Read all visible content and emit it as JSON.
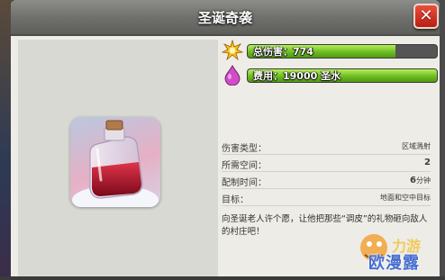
{
  "window": {
    "title": "圣诞奇袭"
  },
  "stats": [
    {
      "label": "总伤害：774",
      "icon": "damage-burst-icon",
      "fill": 0.78
    },
    {
      "label": "费用：19000 圣水",
      "icon": "elixir-drop-icon",
      "fill": 1.0
    }
  ],
  "info": [
    {
      "key": "伤害类型：",
      "value": "区域溅射",
      "small": true
    },
    {
      "key": "所需空间：",
      "value": "2",
      "small": false
    },
    {
      "key": "配制时间：",
      "value": "6",
      "unit": "分钟"
    },
    {
      "key": "目标：",
      "value": "地面和空中目标",
      "small": true
    }
  ],
  "description": "向圣诞老人许个愿，让他把那些“调皮”的礼物砸向敌人的村庄吧！",
  "watermark": {
    "text": "欧漫露"
  },
  "colors": {
    "bar_green": "#6ebd22",
    "close_red": "#c8281a",
    "title_bar": "#6e6e6a"
  }
}
